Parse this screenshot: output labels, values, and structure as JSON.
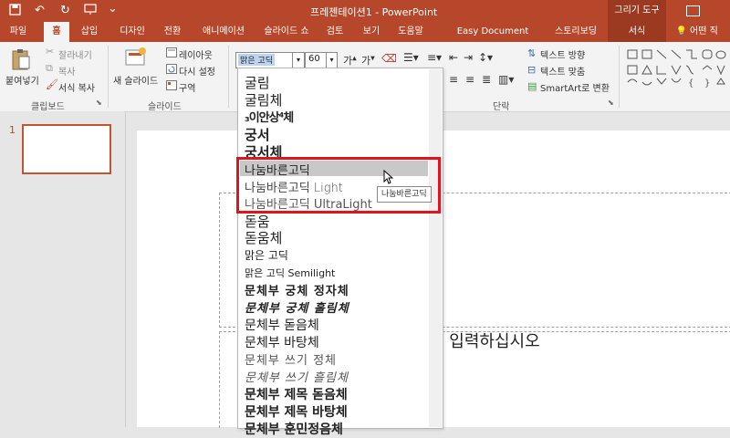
{
  "titlebar": {
    "title": "프레젠테이션1  -  PowerPoint",
    "context_header": "그리기 도구",
    "color": "#b7472a"
  },
  "tabs": [
    {
      "label": "파일"
    },
    {
      "label": "홈"
    },
    {
      "label": "삽입"
    },
    {
      "label": "디자인"
    },
    {
      "label": "전환"
    },
    {
      "label": "애니메이션"
    },
    {
      "label": "슬라이드 쇼"
    },
    {
      "label": "검토"
    },
    {
      "label": "보기"
    },
    {
      "label": "도움말"
    },
    {
      "label": "Easy Document Creator"
    },
    {
      "label": "스토리보딩"
    },
    {
      "label": "서식"
    },
    {
      "label": "어떤 직"
    }
  ],
  "ribbon": {
    "paste": "붙여넣기",
    "cut": "잘라내기",
    "copy": "복사",
    "format_painter": "서식 복사",
    "clipboard_group": "클립보드",
    "new_slide": "새 슬라이드",
    "layout": "레이아웃",
    "reset": "다시 설정",
    "section": "구역",
    "slides_group": "슬라이드",
    "font_name": "맑은 고딕",
    "font_size": "60",
    "text_direction": "텍스트 방향",
    "align_text": "텍스트 맞춤",
    "smartart": "SmartArt로 변환",
    "paragraph_group": "단락"
  },
  "slide_panel": {
    "slide_number": "1"
  },
  "slide": {
    "subtitle_partial": "을 입력하십시오"
  },
  "font_dropdown": {
    "items": [
      "굴림",
      "굴림체",
      "궁서",
      "궁서체",
      "나눔바른고딕",
      "나눔바른고딕 Light",
      "나눔바른고딕 UltraLight",
      "돋움",
      "돋움체",
      "맑은 고딕",
      "맑은 고딕 Semilight",
      "문체부 궁체 정자체",
      "문체부 궁체 흘림체",
      "문체부 돋음체",
      "문체부 바탕체",
      "문체부 쓰기 정체",
      "문체부 쓰기 흘림체",
      "문체부 제목 돋음체",
      "문체부 제목 바탕체"
    ],
    "tooltip": "나눔바른고딕",
    "highlight_color": "#e0141c"
  }
}
